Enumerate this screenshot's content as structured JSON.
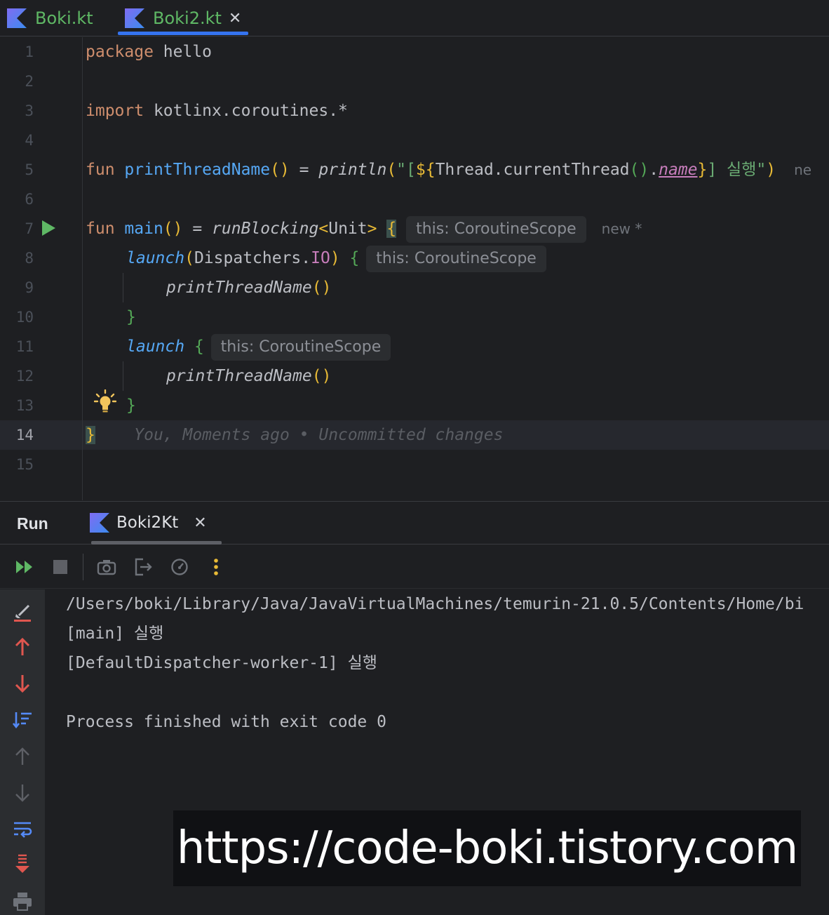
{
  "tabs": [
    {
      "label": "Boki.kt",
      "active": false
    },
    {
      "label": "Boki2.kt",
      "active": true,
      "close": "✕"
    }
  ],
  "editor": {
    "line_numbers": [
      "1",
      "2",
      "3",
      "4",
      "5",
      "6",
      "7",
      "8",
      "9",
      "10",
      "11",
      "12",
      "13",
      "14",
      "15"
    ],
    "current_line": "14",
    "lines": {
      "l1": {
        "kw": "package",
        "rest": " hello"
      },
      "l3": {
        "kw": "import",
        "rest": " kotlinx.coroutines.*"
      },
      "l5": {
        "kw": "fun",
        "fn": "printThreadName",
        "p1": "()",
        "eq": " = ",
        "call": "println",
        "p2": "(",
        "s1": "\"[",
        "tpl_open": "${",
        "cls": "Thread.currentThread",
        "p3": "()",
        "dot": ".",
        "prop": "name",
        "tpl_close": "}",
        "s2": "] 실행\"",
        "p4": ")",
        "trail": "ne"
      },
      "l7": {
        "kw": "fun",
        "fn": "main",
        "p1": "()",
        "eq": " = ",
        "call": "runBlocking",
        "gen_open": "<",
        "gen": "Unit",
        "gen_close": ">",
        "brace": "{",
        "hint": "this: CoroutineScope",
        "new": "new *"
      },
      "l8": {
        "call": "launch",
        "p1": "(",
        "arg1": "Dispatchers.",
        "arg2": "IO",
        "p2": ")",
        "brace": "{",
        "hint": "this: CoroutineScope"
      },
      "l9": {
        "call": "printThreadName",
        "p": "()"
      },
      "l10": {
        "brace": "}"
      },
      "l11": {
        "call": "launch",
        "brace": "{",
        "hint": "this: CoroutineScope"
      },
      "l12": {
        "call": "printThreadName",
        "p": "()"
      },
      "l13": {
        "brace": "}"
      },
      "l14": {
        "brace": "}",
        "blame": "You, Moments ago • Uncommitted changes"
      }
    }
  },
  "run": {
    "title": "Run",
    "tab_label": "Boki2Kt",
    "tab_close": "✕",
    "console": [
      "/Users/boki/Library/Java/JavaVirtualMachines/temurin-21.0.5/Contents/Home/bi",
      "[main] 실행",
      "[DefaultDispatcher-worker-1] 실행",
      "",
      "Process finished with exit code 0"
    ]
  },
  "watermark": "https://code-boki.tistory.com",
  "colors": {
    "background": "#1e1f22",
    "keyword": "#cf8e6d",
    "function": "#56a8f5",
    "string": "#6aab73",
    "property": "#c77dbb",
    "accent_tab": "#3574f0",
    "run_green": "#5fb865"
  }
}
